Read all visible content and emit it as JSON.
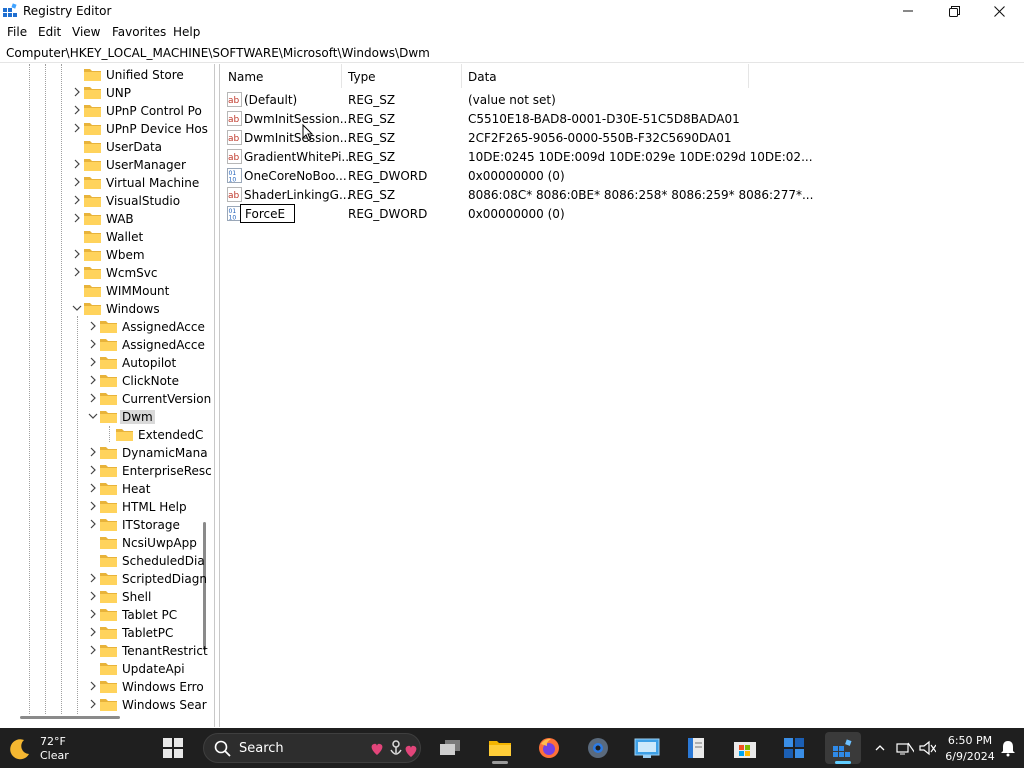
{
  "window": {
    "title": "Registry Editor",
    "minimize_icon": "minimize-icon",
    "maximize_icon": "restore-icon",
    "close_icon": "close-icon"
  },
  "menu": [
    "File",
    "Edit",
    "View",
    "Favorites",
    "Help"
  ],
  "address": {
    "path": "Computer\\HKEY_LOCAL_MACHINE\\SOFTWARE\\Microsoft\\Windows\\Dwm"
  },
  "tree": {
    "items": [
      {
        "label": "Unified Store",
        "expander": false
      },
      {
        "label": "UNP",
        "expander": true
      },
      {
        "label": "UPnP Control Po",
        "expander": true
      },
      {
        "label": "UPnP Device Hos",
        "expander": true
      },
      {
        "label": "UserData",
        "expander": false
      },
      {
        "label": "UserManager",
        "expander": true
      },
      {
        "label": "Virtual Machine",
        "expander": true
      },
      {
        "label": "VisualStudio",
        "expander": true
      },
      {
        "label": "WAB",
        "expander": true
      },
      {
        "label": "Wallet",
        "expander": false
      },
      {
        "label": "Wbem",
        "expander": true
      },
      {
        "label": "WcmSvc",
        "expander": true
      },
      {
        "label": "WIMMount",
        "expander": false
      },
      {
        "label": "Windows",
        "expander": "open"
      },
      {
        "label": "AssignedAcce",
        "expander": true
      },
      {
        "label": "AssignedAcce",
        "expander": true
      },
      {
        "label": "Autopilot",
        "expander": true
      },
      {
        "label": "ClickNote",
        "expander": true
      },
      {
        "label": "CurrentVersion",
        "expander": true
      },
      {
        "label": "Dwm",
        "expander": "open",
        "selected": true
      },
      {
        "label": "ExtendedC",
        "expander": false
      },
      {
        "label": "DynamicMana",
        "expander": true
      },
      {
        "label": "EnterpriseResc",
        "expander": true
      },
      {
        "label": "Heat",
        "expander": true
      },
      {
        "label": "HTML Help",
        "expander": true
      },
      {
        "label": "ITStorage",
        "expander": true
      },
      {
        "label": "NcsiUwpApp",
        "expander": false
      },
      {
        "label": "ScheduledDia",
        "expander": false
      },
      {
        "label": "ScriptedDiagn",
        "expander": true
      },
      {
        "label": "Shell",
        "expander": true
      },
      {
        "label": "Tablet PC",
        "expander": true
      },
      {
        "label": "TabletPC",
        "expander": true
      },
      {
        "label": "TenantRestrict",
        "expander": true
      },
      {
        "label": "UpdateApi",
        "expander": false
      },
      {
        "label": "Windows Erro",
        "expander": true
      },
      {
        "label": "Windows Sear",
        "expander": true
      }
    ]
  },
  "list": {
    "columns": [
      "Name",
      "Type",
      "Data"
    ],
    "rows": [
      {
        "icon": "string-value-icon",
        "name": "(Default)",
        "type": "REG_SZ",
        "data": "(value not set)"
      },
      {
        "icon": "string-value-icon",
        "name": "DwmInitSession...",
        "type": "REG_SZ",
        "data": "C5510E18-BAD8-0001-D30E-51C5D8BADA01"
      },
      {
        "icon": "string-value-icon",
        "name": "DwmInitSession...",
        "type": "REG_SZ",
        "data": "2CF2F265-9056-0000-550B-F32C5690DA01"
      },
      {
        "icon": "string-value-icon",
        "name": "GradientWhitePi...",
        "type": "REG_SZ",
        "data": "10DE:0245 10DE:009d 10DE:029e 10DE:029d 10DE:02..."
      },
      {
        "icon": "dword-value-icon",
        "name": "OneCoreNoBoo...",
        "type": "REG_DWORD",
        "data": "0x00000000 (0)"
      },
      {
        "icon": "string-value-icon",
        "name": "ShaderLinkingG...",
        "type": "REG_SZ",
        "data": "8086:08C* 8086:0BE* 8086:258* 8086:259* 8086:277*..."
      },
      {
        "icon": "dword-value-icon",
        "name": "ForceE",
        "type": "REG_DWORD",
        "data": "0x00000000 (0)",
        "editing": true
      }
    ]
  },
  "taskbar": {
    "weather": {
      "temp": "72°F",
      "condition": "Clear"
    },
    "search_label": "Search",
    "apps": [
      "start-icon",
      "search-icon",
      "task-view-icon",
      "file-explorer-icon",
      "firefox-icon",
      "settings-icon",
      "control-panel-icon",
      "notepad-icon",
      "store-icon",
      "start-menu-app-icon",
      "registry-editor-icon"
    ],
    "clock": {
      "time": "6:50 PM",
      "date": "6/9/2024"
    }
  }
}
